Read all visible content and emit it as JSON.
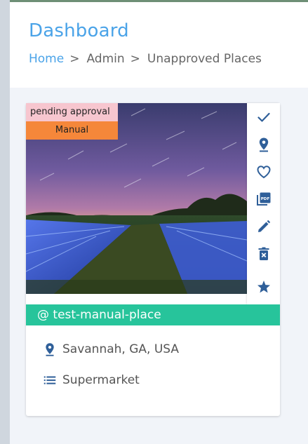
{
  "header": {
    "title": "Dashboard",
    "breadcrumb": {
      "home": "Home",
      "admin": "Admin",
      "current": "Unapproved Places",
      "separator": ">"
    }
  },
  "card": {
    "badges": {
      "pending": "pending approval",
      "type": "Manual"
    },
    "name": "@ test-manual-place",
    "location": "Savannah, GA, USA",
    "category": "Supermarket",
    "actions": [
      "check-icon",
      "location-pin-icon",
      "heart-icon",
      "pdf-icon",
      "edit-icon",
      "delete-icon",
      "star-icon"
    ]
  },
  "colors": {
    "accent_blue": "#4aa3e8",
    "icon_blue": "#2f5f99",
    "name_bar": "#27c49b",
    "pending_badge": "#f7c6cf",
    "manual_badge": "#f5873a"
  }
}
